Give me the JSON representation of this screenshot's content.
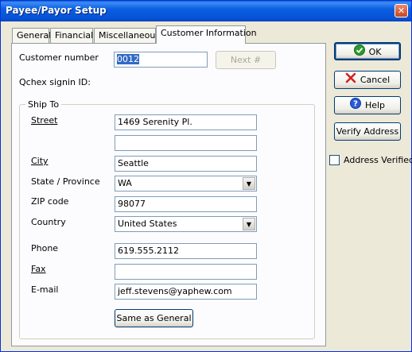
{
  "window": {
    "title": "Payee/Payor Setup",
    "close_symbol": "✕"
  },
  "tabs": [
    {
      "label": "General"
    },
    {
      "label": "Financial"
    },
    {
      "label": "Miscellaneous"
    },
    {
      "label": "Customer Information"
    }
  ],
  "form": {
    "customer_number_label": "Customer number",
    "customer_number_value": "0012",
    "next_button": "Next #",
    "qchex_label": "Qchex signin ID:",
    "ship_to_title": "Ship To",
    "street_label": "Street",
    "street_value": "1469 Serenity Pl.",
    "street2_value": "",
    "city_label": "City",
    "city_value": "Seattle",
    "state_label": "State / Province",
    "state_value": "WA",
    "zip_label": "ZIP code",
    "zip_value": "98077",
    "country_label": "Country",
    "country_value": "United States",
    "phone_label": "Phone",
    "phone_value": "619.555.2112",
    "fax_label": "Fax",
    "fax_value": "",
    "email_label": "E-mail",
    "email_value": "jeff.stevens@yaphew.com",
    "same_as_general_button": "Same as General"
  },
  "side": {
    "ok_label": "OK",
    "cancel_label": "Cancel",
    "help_label": "Help",
    "verify_label": "Verify Address",
    "address_verified_label": "Address Verified",
    "address_verified_checked": false
  },
  "icons": {
    "ok": "check-circle-icon",
    "cancel": "red-x-icon",
    "help": "question-icon",
    "combo": "chevron-down-icon"
  },
  "colors": {
    "title_bar": "#0554e3",
    "selection": "#316ac5",
    "background": "#ece9d8"
  }
}
